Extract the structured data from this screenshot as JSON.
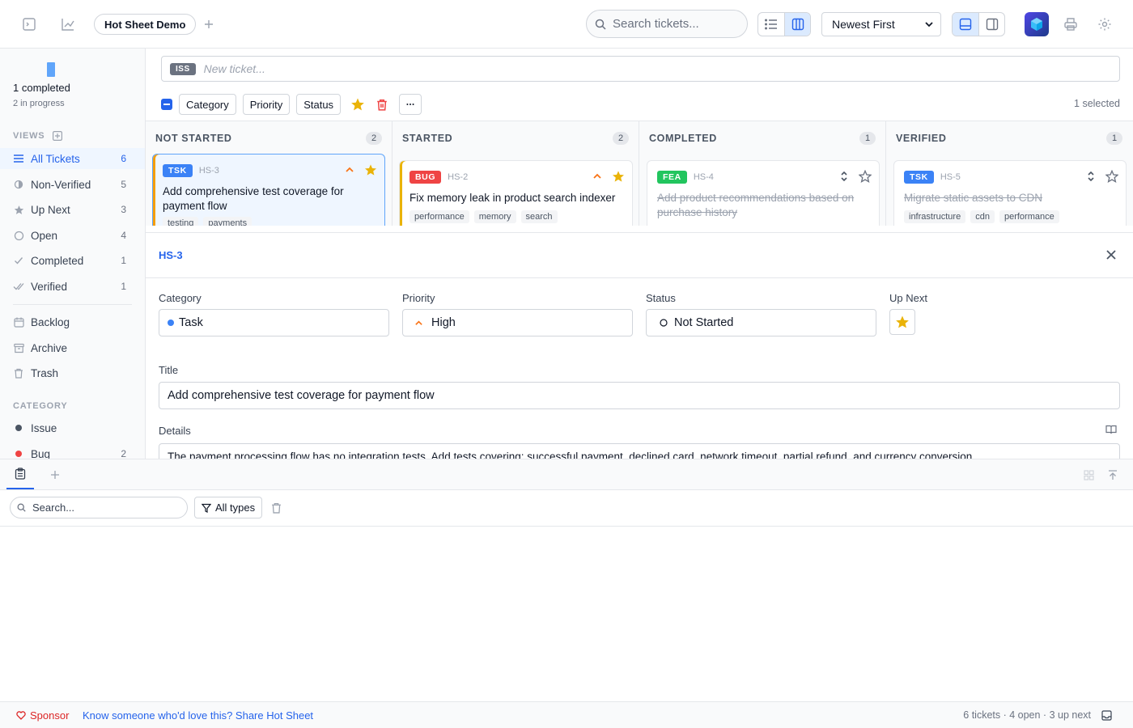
{
  "topbar": {
    "project_tab": "Hot Sheet Demo",
    "search_placeholder": "Search tickets...",
    "sort_value": "Newest First"
  },
  "sidebar": {
    "completed_label": "1 completed",
    "in_progress_label": "2 in progress",
    "views_heading": "VIEWS",
    "views": [
      {
        "label": "All Tickets",
        "count": "6",
        "icon": "list-icon",
        "active": true
      },
      {
        "label": "Non-Verified",
        "count": "5",
        "icon": "half-circle-icon"
      },
      {
        "label": "Up Next",
        "count": "3",
        "icon": "star-icon"
      },
      {
        "label": "Open",
        "count": "4",
        "icon": "circle-icon"
      },
      {
        "label": "Completed",
        "count": "1",
        "icon": "check-icon"
      },
      {
        "label": "Verified",
        "count": "1",
        "icon": "double-check-icon"
      }
    ],
    "archive_items": [
      {
        "label": "Backlog",
        "icon": "calendar-icon"
      },
      {
        "label": "Archive",
        "icon": "archive-icon"
      },
      {
        "label": "Trash",
        "icon": "trash-icon"
      }
    ],
    "category_heading": "CATEGORY",
    "categories": [
      {
        "label": "Issue",
        "count": "",
        "color": "#4b5563"
      },
      {
        "label": "Bug",
        "count": "2",
        "color": "#ef4444"
      }
    ]
  },
  "new_ticket": {
    "type_badge": "ISS",
    "placeholder": "New ticket..."
  },
  "toolbar": {
    "category_label": "Category",
    "priority_label": "Priority",
    "status_label": "Status",
    "selected_count": "1 selected"
  },
  "columns": [
    {
      "title": "NOT STARTED",
      "count": "2",
      "card": {
        "cat": "TSK",
        "cat_color": "#3b82f6",
        "id": "HS-3",
        "title": "Add comprehensive test coverage for payment flow",
        "tags": [
          "testing",
          "payments"
        ],
        "done": false
      }
    },
    {
      "title": "STARTED",
      "count": "2",
      "card": {
        "cat": "BUG",
        "cat_color": "#ef4444",
        "id": "HS-2",
        "title": "Fix memory leak in product search indexer",
        "tags": [
          "performance",
          "memory",
          "search"
        ],
        "done": false
      }
    },
    {
      "title": "COMPLETED",
      "count": "1",
      "card": {
        "cat": "FEA",
        "cat_color": "#22c55e",
        "id": "HS-4",
        "title": "Add product recommendations based on purchase history",
        "tags": [],
        "done": true
      }
    },
    {
      "title": "VERIFIED",
      "count": "1",
      "card": {
        "cat": "TSK",
        "cat_color": "#3b82f6",
        "id": "HS-5",
        "title": "Migrate static assets to CDN",
        "tags": [
          "infrastructure",
          "cdn",
          "performance"
        ],
        "done": true
      }
    }
  ],
  "detail": {
    "ticket_id": "HS-3",
    "category_label": "Category",
    "category_value": "Task",
    "priority_label": "Priority",
    "priority_value": "High",
    "status_label": "Status",
    "status_value": "Not Started",
    "upnext_label": "Up Next",
    "title_label": "Title",
    "title_value": "Add comprehensive test coverage for payment flow",
    "details_label": "Details",
    "details_value": "The payment processing flow has no integration tests. Add tests covering: successful payment, declined card, network timeout, partial refund, and currency conversion."
  },
  "log": {
    "search_placeholder": "Search...",
    "filter_label": "All types"
  },
  "footer": {
    "sponsor": "Sponsor",
    "share": "Know someone who'd love this? Share Hot Sheet",
    "stats": "6 tickets · 4 open · 3 up next"
  },
  "colors": {
    "accent": "#2563eb",
    "star": "#eab308",
    "priority_high": "#f97316",
    "danger": "#ef4444"
  }
}
